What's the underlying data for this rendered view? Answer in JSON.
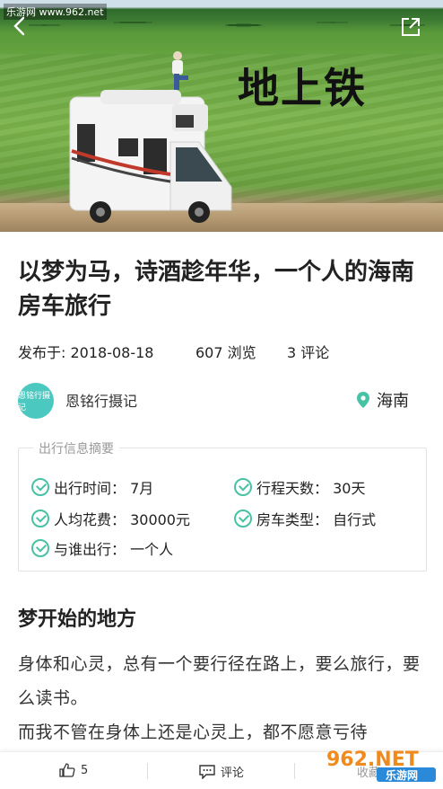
{
  "hero": {
    "watermark": "乐游网 www.962.net",
    "title": "地上铁"
  },
  "article": {
    "title": "以梦为马，诗酒趁年华，一个人的海南房车旅行",
    "publish_label": "发布于: 2018-08-18",
    "views": "607 浏览",
    "comments": "3 评论"
  },
  "author": {
    "avatar_text": "恩铭行摄记",
    "name": "恩铭行摄记",
    "location": "海南"
  },
  "summary": {
    "label": "出行信息摘要",
    "items": [
      "出行时间： 7月",
      "行程天数： 30天",
      "人均花费： 30000元",
      "房车类型： 自行式",
      "与谁出行： 一个人"
    ]
  },
  "section": {
    "title": "梦开始的地方",
    "paragraph1": "身体和心灵，总有一个要行径在路上，要么旅行，要么读书。",
    "paragraph2": "而我不管在身体上还是心灵上，都不愿意亏待"
  },
  "bottom_bar": {
    "like_count": "5",
    "comment_label": "评论",
    "collect_label": "收藏"
  },
  "logo": {
    "text": "962.NET",
    "sub": "乐游网"
  },
  "colors": {
    "accent": "#47c2a4",
    "avatar": "#4bc9c0"
  }
}
